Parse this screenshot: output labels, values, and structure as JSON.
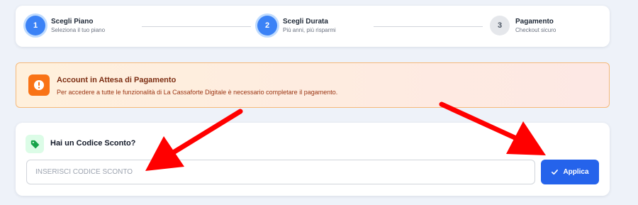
{
  "stepper": {
    "steps": [
      {
        "number": "1",
        "title": "Scegli Piano",
        "subtitle": "Seleziona il tuo piano",
        "state": "active"
      },
      {
        "number": "2",
        "title": "Scegli Durata",
        "subtitle": "Più anni, più risparmi",
        "state": "active"
      },
      {
        "number": "3",
        "title": "Pagamento",
        "subtitle": "Checkout sicuro",
        "state": "inactive"
      }
    ]
  },
  "alert": {
    "icon": "exclamation-circle-icon",
    "title": "Account in Attesa di Pagamento",
    "message": "Per accedere a tutte le funzionalità di La Cassaforte Digitale è necessario completare il pagamento."
  },
  "discount": {
    "icon": "tag-icon",
    "title": "Hai un Codice Sconto?",
    "input_placeholder": "INSERISCI CODICE SCONTO",
    "input_value": "",
    "apply_label": "Applica"
  },
  "colors": {
    "primary": "#2563eb",
    "step_active": "#3b82f6",
    "alert_icon": "#f97316",
    "annotation_arrow": "#ff0000"
  }
}
